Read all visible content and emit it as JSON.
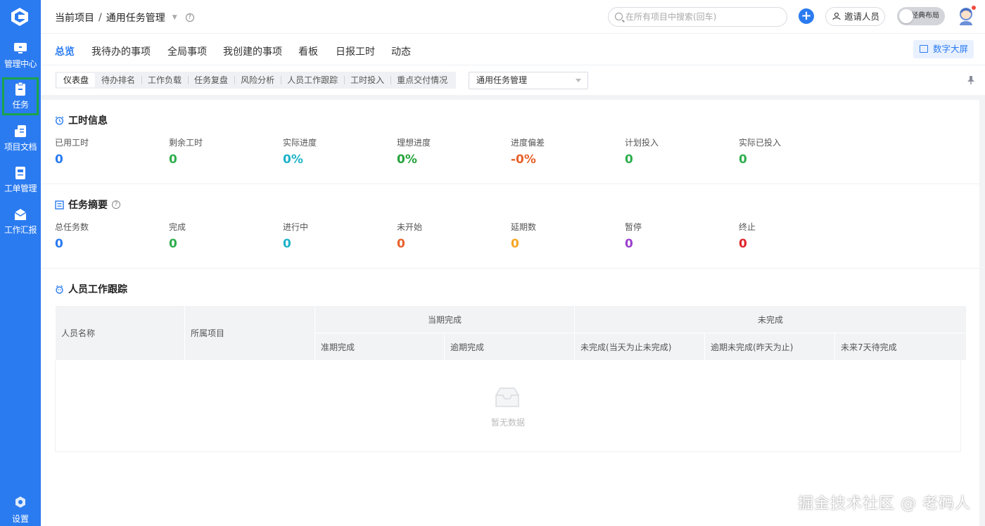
{
  "sidebar": {
    "items": [
      {
        "label": "管理中心",
        "icon": "monitor-icon"
      },
      {
        "label": "任务",
        "icon": "clipboard-icon"
      },
      {
        "label": "项目文档",
        "icon": "document-icon"
      },
      {
        "label": "工单管理",
        "icon": "ticket-icon"
      },
      {
        "label": "工作汇报",
        "icon": "report-icon"
      }
    ],
    "settings_label": "设置"
  },
  "header": {
    "breadcrumb_root": "当前项目",
    "breadcrumb_sep": "/",
    "breadcrumb_current": "通用任务管理",
    "help": "?",
    "search_placeholder": "在所有项目中搜索(回车)",
    "plus": "+",
    "invite_label": "邀请人员",
    "layout_toggle_label": "经典布局"
  },
  "tabs": [
    {
      "label": "总览"
    },
    {
      "label": "我待办的事项"
    },
    {
      "label": "全局事项"
    },
    {
      "label": "我创建的事项"
    },
    {
      "label": "看板"
    },
    {
      "label": "日报工时"
    },
    {
      "label": "动态"
    }
  ],
  "bigscreen_label": "数字大屏",
  "subtabs": [
    {
      "label": "仪表盘"
    },
    {
      "label": "待办排名"
    },
    {
      "label": "工作负载"
    },
    {
      "label": "任务复盘"
    },
    {
      "label": "风险分析"
    },
    {
      "label": "人员工作跟踪"
    },
    {
      "label": "工时投入"
    },
    {
      "label": "重点交付情况"
    }
  ],
  "project_select": "通用任务管理",
  "work_hours": {
    "title": "工时信息",
    "stats": [
      {
        "label": "已用工时",
        "value": "0",
        "color": "#2b7bf0"
      },
      {
        "label": "剩余工时",
        "value": "0",
        "color": "#2fae4e"
      },
      {
        "label": "实际进度",
        "value": "0%",
        "color": "#1fb3c9"
      },
      {
        "label": "理想进度",
        "value": "0%",
        "color": "#23a33a"
      },
      {
        "label": "进度偏差",
        "value": "-0%",
        "color": "#e8612c"
      },
      {
        "label": "计划投入",
        "value": "0",
        "color": "#2fae4e"
      },
      {
        "label": "实际已投入",
        "value": "0",
        "color": "#2fae4e"
      }
    ]
  },
  "task_summary": {
    "title": "任务摘要",
    "help": "?",
    "stats": [
      {
        "label": "总任务数",
        "value": "0",
        "color": "#2b7bf0"
      },
      {
        "label": "完成",
        "value": "0",
        "color": "#2fae4e"
      },
      {
        "label": "进行中",
        "value": "0",
        "color": "#1fb3c9"
      },
      {
        "label": "未开始",
        "value": "0",
        "color": "#e8612c"
      },
      {
        "label": "延期数",
        "value": "0",
        "color": "#f5a623"
      },
      {
        "label": "暂停",
        "value": "0",
        "color": "#9b3fcf"
      },
      {
        "label": "终止",
        "value": "0",
        "color": "#e0262c"
      }
    ]
  },
  "tracking": {
    "title": "人员工作跟踪",
    "columns": {
      "name": "人员名称",
      "project": "所属项目",
      "period_done": "当期完成",
      "on_time": "准期完成",
      "overdue_done": "逾期完成",
      "unfinished": "未完成",
      "unfinished_today": "未完成(当天为止未完成)",
      "overdue_unfinished": "逾期未完成(昨天为止)",
      "next7": "未来7天待完成"
    },
    "empty_text": "暂无数据"
  },
  "watermark": "掘金技术社区 @ 老码人"
}
